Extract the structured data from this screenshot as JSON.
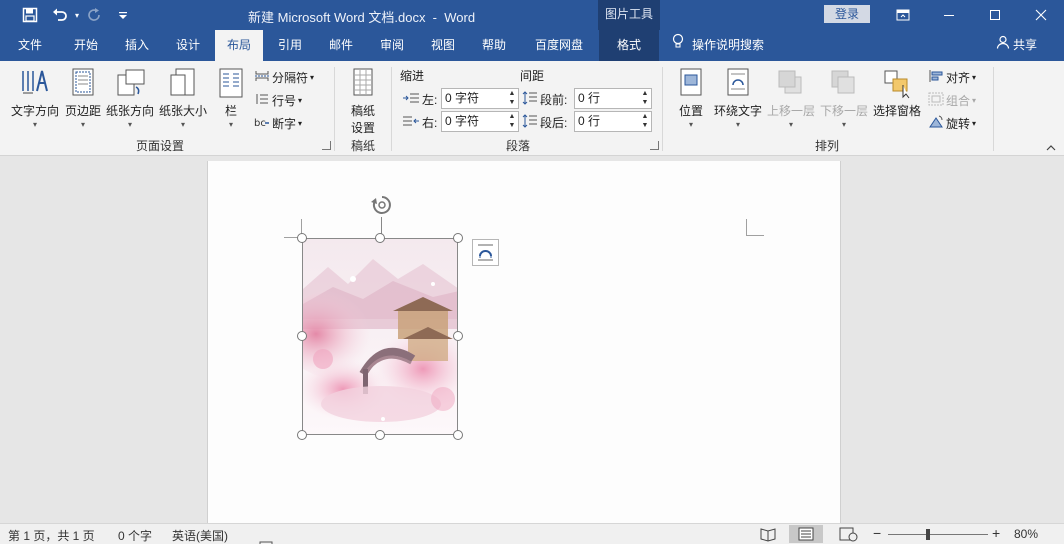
{
  "titlebar": {
    "title": "新建 Microsoft Word 文档.docx  -  Word",
    "context_title": "图片工具",
    "login_label": "登录",
    "icons": [
      "save-icon",
      "undo-icon",
      "redo-icon",
      "customize-qat-icon"
    ]
  },
  "tabs": [
    {
      "label": "文件"
    },
    {
      "label": "开始"
    },
    {
      "label": "插入"
    },
    {
      "label": "设计"
    },
    {
      "label": "布局"
    },
    {
      "label": "引用"
    },
    {
      "label": "邮件"
    },
    {
      "label": "审阅"
    },
    {
      "label": "视图"
    },
    {
      "label": "帮助"
    },
    {
      "label": "百度网盘"
    },
    {
      "label": "格式"
    }
  ],
  "active_tab": "布局",
  "tell_me": "操作说明搜索",
  "share": "共享",
  "ribbon": {
    "page_setup": {
      "label": "页面设置",
      "text_direction": "文字方向",
      "margins": "页边距",
      "orientation": "纸张方向",
      "size": "纸张大小",
      "columns": "栏",
      "breaks": "分隔符",
      "line_numbers": "行号",
      "hyphenation": "断字"
    },
    "draft": {
      "label": "稿纸",
      "draft_settings_line1": "稿纸",
      "draft_settings_line2": "设置"
    },
    "paragraph": {
      "label": "段落",
      "indent_title": "缩进",
      "spacing_title": "间距",
      "left_label": "左:",
      "left_value": "0 字符",
      "right_label": "右:",
      "right_value": "0 字符",
      "before_label": "段前:",
      "before_value": "0 行",
      "after_label": "段后:",
      "after_value": "0 行"
    },
    "arrange": {
      "label": "排列",
      "position": "位置",
      "wrap_text": "环绕文字",
      "bring_forward": "上移一层",
      "send_backward": "下移一层",
      "selection_pane": "选择窗格",
      "align": "对齐",
      "group": "组合",
      "rotate": "旋转"
    }
  },
  "statusbar": {
    "page_info": "第 1 页，共 1 页",
    "word_count": "0 个字",
    "language": "英语(美国)",
    "zoom_minus": "−",
    "zoom_plus": "+",
    "zoom_level": "80%",
    "zoom_fraction": 0.4
  },
  "colors": {
    "brand": "#2b579a",
    "context_tab": "#1f3f72",
    "ribbon_bg": "#f3f3f3",
    "canvas_bg": "#e6e6e6"
  }
}
